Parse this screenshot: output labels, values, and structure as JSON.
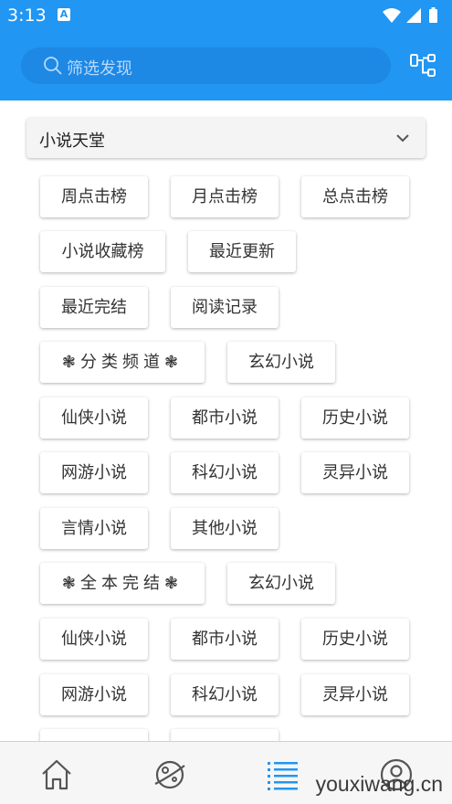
{
  "status_bar": {
    "time": "3:13",
    "app_icon": "A"
  },
  "search": {
    "placeholder": "筛选发现",
    "icon": "search-icon"
  },
  "header_action_icon": "tree-structure-icon",
  "source_select": {
    "selected": "小说天堂"
  },
  "chips": [
    "周点击榜",
    "月点击榜",
    "总点击榜",
    "小说收藏榜",
    "最近更新",
    "最近完结",
    "阅读记录",
    "❃分类频道❃",
    "玄幻小说",
    "仙侠小说",
    "都市小说",
    "历史小说",
    "网游小说",
    "科幻小说",
    "灵异小说",
    "言情小说",
    "其他小说",
    "❃全本完结❃",
    "玄幻小说",
    "仙侠小说",
    "都市小说",
    "历史小说",
    "网游小说",
    "科幻小说",
    "灵异小说",
    "",
    ""
  ],
  "bottom_nav": [
    {
      "name": "home",
      "icon": "home-icon"
    },
    {
      "name": "discover",
      "icon": "compass-icon"
    },
    {
      "name": "list",
      "icon": "list-icon",
      "active": true
    },
    {
      "name": "profile",
      "icon": "user-icon"
    }
  ],
  "watermark": "youxiwang.cn",
  "colors": {
    "primary": "#2196F3",
    "active_nav": "#2196F3"
  }
}
